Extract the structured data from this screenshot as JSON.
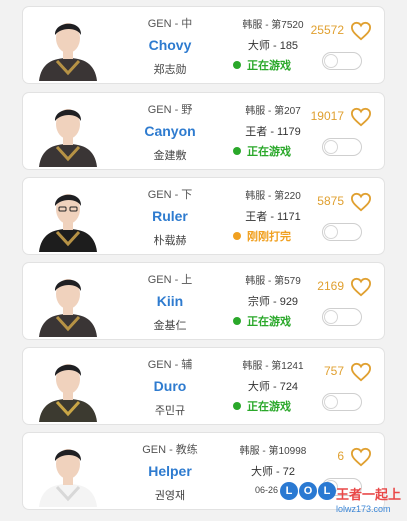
{
  "colors": {
    "name": "#2e7bcf",
    "likes": "#e0a030",
    "status_playing": "#2aa82a",
    "status_finished": "#f0a020"
  },
  "players": [
    {
      "team_pos": "GEN - 中",
      "name": "Chovy",
      "realname": "郑志勋",
      "server": "韩服 - 第7520",
      "rank": "大师 - 185",
      "status": "正在游戏",
      "status_type": "playing",
      "likes": "25572",
      "jersey": "dark"
    },
    {
      "team_pos": "GEN - 野",
      "name": "Canyon",
      "realname": "金建敷",
      "server": "韩服 - 第207",
      "rank": "王者 - 1179",
      "status": "正在游戏",
      "status_type": "playing",
      "likes": "19017",
      "jersey": "dark"
    },
    {
      "team_pos": "GEN - 下",
      "name": "Ruler",
      "realname": "朴载赫",
      "server": "韩服 - 第220",
      "rank": "王者 - 1171",
      "status": "刚刚打完",
      "status_type": "finished",
      "likes": "5875",
      "jersey": "black"
    },
    {
      "team_pos": "GEN - 上",
      "name": "Kiin",
      "realname": "金基仁",
      "server": "韩服 - 第579",
      "rank": "宗师 - 929",
      "status": "正在游戏",
      "status_type": "playing",
      "likes": "2169",
      "jersey": "dark"
    },
    {
      "team_pos": "GEN - 辅",
      "name": "Duro",
      "realname": "주민규",
      "server": "韩服 - 第1241",
      "rank": "大师 - 724",
      "status": "正在游戏",
      "status_type": "playing",
      "likes": "757",
      "jersey": "gold"
    },
    {
      "team_pos": "GEN - 教练",
      "name": "Helper",
      "realname": "권영재",
      "server": "韩服 - 第10998",
      "rank": "大师 - 72",
      "status": "06-26 19:1",
      "status_type": "time",
      "likes": "6",
      "jersey": "white"
    }
  ],
  "watermark": {
    "letters": [
      "L",
      "O",
      "L"
    ],
    "title": "王者一起上",
    "url": "lolwz173.com"
  }
}
